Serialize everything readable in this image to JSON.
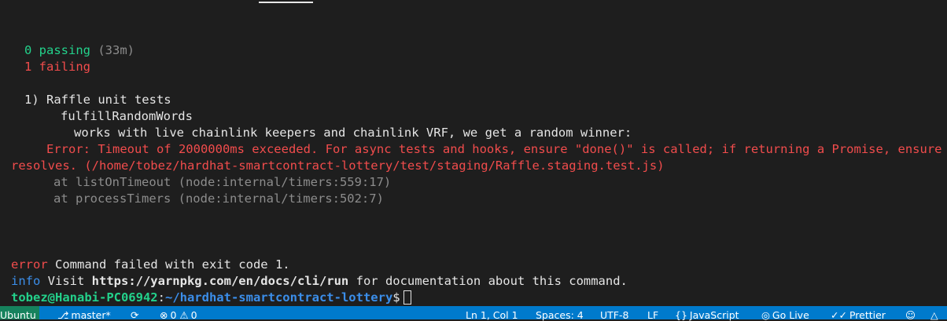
{
  "terminal": {
    "passing": "0 passing",
    "passing_time": "(33m)",
    "failing": "1 failing",
    "suite": "1) Raffle unit tests",
    "describe": "fulfillRandomWords",
    "test": "works with live chainlink keepers and chainlink VRF, we get a random winner:",
    "error_line1": "Error: Timeout of 2000000ms exceeded. For async tests and hooks, ensure \"done()\" is called; if returning a Promise, ensure it",
    "error_line2": "resolves. (/home/tobez/hardhat-smartcontract-lottery/test/staging/Raffle.staging.test.js)",
    "stack1": "at listOnTimeout (node:internal/timers:559:17)",
    "stack2": "at processTimers (node:internal/timers:502:7)",
    "error_label": "error",
    "error_msg": " Command failed with exit code 1.",
    "info_label": "info",
    "info_visit": " Visit ",
    "info_url": "https://yarnpkg.com/en/docs/cli/run",
    "info_rest": " for documentation about this command.",
    "prompt_user": "tobez@Hanabi-PC06942",
    "prompt_sep": ":",
    "prompt_path": "~/hardhat-smartcontract-lottery",
    "prompt_symbol": "$"
  },
  "statusbar": {
    "remote": "Ubuntu",
    "branch": "master*",
    "errors": "0",
    "warnings": "0",
    "position": "Ln 1, Col 1",
    "spaces": "Spaces: 4",
    "encoding": "UTF-8",
    "eol": "LF",
    "language": "JavaScript",
    "golive": "Go Live",
    "prettier": "Prettier",
    "colors": {
      "background": "#007acc",
      "remote": "#16825d"
    }
  }
}
